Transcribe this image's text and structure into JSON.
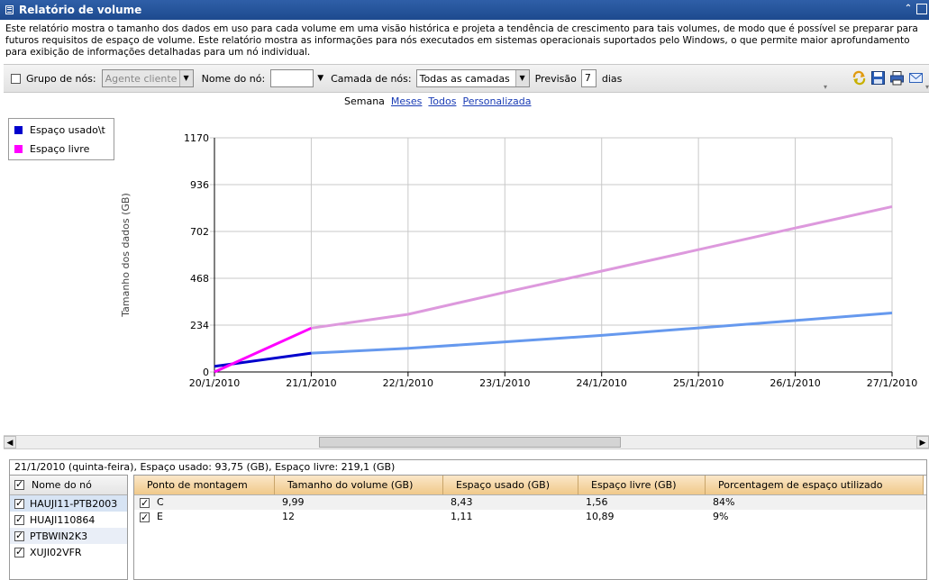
{
  "window": {
    "title": "Relatório de volume"
  },
  "description": "Este relatório mostra o tamanho dos dados em uso para cada volume em uma visão histórica e projeta a tendência de crescimento para tais volumes, de modo que é possível se preparar para futuros requisitos de espaço de volume. Este relatório mostra as informações para nós executados em sistemas operacionais suportados pelo Windows, o que permite maior aprofundamento para exibição de informações detalhadas para um nó individual.",
  "toolbar": {
    "group_label": "Grupo de nós:",
    "group_value": "Agente cliente",
    "node_label": "Nome do nó:",
    "node_value": "",
    "tier_label": "Camada de nós:",
    "tier_value": "Todas as camadas",
    "forecast_label": "Previsão",
    "forecast_value": "7",
    "forecast_unit": "dias",
    "icons": [
      "refresh-icon",
      "save-icon",
      "print-icon",
      "email-icon"
    ]
  },
  "periods": {
    "current": "Semana",
    "months": "Meses",
    "all": "Todos",
    "custom": "Personalizada"
  },
  "legend": {
    "used": "Espaço usado\\t",
    "free": "Espaço livre"
  },
  "chart_data": {
    "type": "line",
    "ylabel": "Tamanho dos dados (GB)",
    "xlabel": "",
    "ylim": [
      0,
      1170
    ],
    "yticks": [
      0,
      234,
      468,
      702,
      936,
      1170
    ],
    "x": [
      "20/1/2010",
      "21/1/2010",
      "22/1/2010",
      "23/1/2010",
      "24/1/2010",
      "25/1/2010",
      "26/1/2010",
      "27/1/2010"
    ],
    "grid": true,
    "legend_position": "top-left",
    "series": [
      {
        "name": "Espaço usado\\t",
        "color": "#0000cc",
        "values": [
          28,
          93.75,
          null,
          null,
          null,
          null,
          null,
          null
        ]
      },
      {
        "name": "Espaço livre",
        "color": "#ff00ff",
        "values": [
          0,
          219.1,
          null,
          null,
          null,
          null,
          null,
          null
        ]
      },
      {
        "name": "",
        "color": "#6699ee",
        "values": [
          null,
          93.75,
          118,
          150,
          183,
          220,
          257,
          295
        ]
      },
      {
        "name": "",
        "color": "#dd99dd",
        "values": [
          null,
          219.1,
          288,
          398,
          504,
          611,
          719,
          826
        ]
      }
    ]
  },
  "status": "21/1/2010 (quinta-feira), Espaço usado: 93,75 (GB), Espaço livre: 219,1 (GB)",
  "nodes": {
    "header": "Nome do nó",
    "items": [
      "HAUJI11-PTB2003",
      "HUAJI110864",
      "PTBWIN2K3",
      "XUJI02VFR"
    ]
  },
  "detail": {
    "columns": [
      "Ponto de montagem",
      "Tamanho do volume (GB)",
      "Espaço usado (GB)",
      "Espaço livre (GB)",
      "Porcentagem de espaço utilizado"
    ],
    "rows": [
      [
        "C",
        "9,99",
        "8,43",
        "1,56",
        "84%"
      ],
      [
        "E",
        "12",
        "1,11",
        "10,89",
        "9%"
      ]
    ]
  },
  "colors": {
    "title_bar": "#1d4a8e",
    "header_orange": "#f0c98a",
    "link": "#1a3cb5"
  }
}
